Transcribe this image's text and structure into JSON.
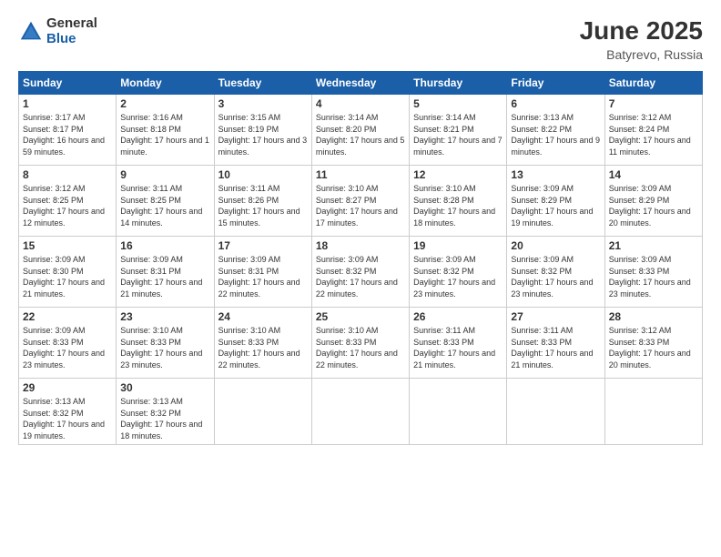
{
  "logo": {
    "general": "General",
    "blue": "Blue"
  },
  "title": "June 2025",
  "location": "Batyrevo, Russia",
  "days_of_week": [
    "Sunday",
    "Monday",
    "Tuesday",
    "Wednesday",
    "Thursday",
    "Friday",
    "Saturday"
  ],
  "weeks": [
    [
      {
        "day": "1",
        "sunrise": "3:17 AM",
        "sunset": "8:17 PM",
        "daylight": "16 hours and 59 minutes."
      },
      {
        "day": "2",
        "sunrise": "3:16 AM",
        "sunset": "8:18 PM",
        "daylight": "17 hours and 1 minute."
      },
      {
        "day": "3",
        "sunrise": "3:15 AM",
        "sunset": "8:19 PM",
        "daylight": "17 hours and 3 minutes."
      },
      {
        "day": "4",
        "sunrise": "3:14 AM",
        "sunset": "8:20 PM",
        "daylight": "17 hours and 5 minutes."
      },
      {
        "day": "5",
        "sunrise": "3:14 AM",
        "sunset": "8:21 PM",
        "daylight": "17 hours and 7 minutes."
      },
      {
        "day": "6",
        "sunrise": "3:13 AM",
        "sunset": "8:22 PM",
        "daylight": "17 hours and 9 minutes."
      },
      {
        "day": "7",
        "sunrise": "3:12 AM",
        "sunset": "8:24 PM",
        "daylight": "17 hours and 11 minutes."
      }
    ],
    [
      {
        "day": "8",
        "sunrise": "3:12 AM",
        "sunset": "8:25 PM",
        "daylight": "17 hours and 12 minutes."
      },
      {
        "day": "9",
        "sunrise": "3:11 AM",
        "sunset": "8:25 PM",
        "daylight": "17 hours and 14 minutes."
      },
      {
        "day": "10",
        "sunrise": "3:11 AM",
        "sunset": "8:26 PM",
        "daylight": "17 hours and 15 minutes."
      },
      {
        "day": "11",
        "sunrise": "3:10 AM",
        "sunset": "8:27 PM",
        "daylight": "17 hours and 17 minutes."
      },
      {
        "day": "12",
        "sunrise": "3:10 AM",
        "sunset": "8:28 PM",
        "daylight": "17 hours and 18 minutes."
      },
      {
        "day": "13",
        "sunrise": "3:09 AM",
        "sunset": "8:29 PM",
        "daylight": "17 hours and 19 minutes."
      },
      {
        "day": "14",
        "sunrise": "3:09 AM",
        "sunset": "8:29 PM",
        "daylight": "17 hours and 20 minutes."
      }
    ],
    [
      {
        "day": "15",
        "sunrise": "3:09 AM",
        "sunset": "8:30 PM",
        "daylight": "17 hours and 21 minutes."
      },
      {
        "day": "16",
        "sunrise": "3:09 AM",
        "sunset": "8:31 PM",
        "daylight": "17 hours and 21 minutes."
      },
      {
        "day": "17",
        "sunrise": "3:09 AM",
        "sunset": "8:31 PM",
        "daylight": "17 hours and 22 minutes."
      },
      {
        "day": "18",
        "sunrise": "3:09 AM",
        "sunset": "8:32 PM",
        "daylight": "17 hours and 22 minutes."
      },
      {
        "day": "19",
        "sunrise": "3:09 AM",
        "sunset": "8:32 PM",
        "daylight": "17 hours and 23 minutes."
      },
      {
        "day": "20",
        "sunrise": "3:09 AM",
        "sunset": "8:32 PM",
        "daylight": "17 hours and 23 minutes."
      },
      {
        "day": "21",
        "sunrise": "3:09 AM",
        "sunset": "8:33 PM",
        "daylight": "17 hours and 23 minutes."
      }
    ],
    [
      {
        "day": "22",
        "sunrise": "3:09 AM",
        "sunset": "8:33 PM",
        "daylight": "17 hours and 23 minutes."
      },
      {
        "day": "23",
        "sunrise": "3:10 AM",
        "sunset": "8:33 PM",
        "daylight": "17 hours and 23 minutes."
      },
      {
        "day": "24",
        "sunrise": "3:10 AM",
        "sunset": "8:33 PM",
        "daylight": "17 hours and 22 minutes."
      },
      {
        "day": "25",
        "sunrise": "3:10 AM",
        "sunset": "8:33 PM",
        "daylight": "17 hours and 22 minutes."
      },
      {
        "day": "26",
        "sunrise": "3:11 AM",
        "sunset": "8:33 PM",
        "daylight": "17 hours and 21 minutes."
      },
      {
        "day": "27",
        "sunrise": "3:11 AM",
        "sunset": "8:33 PM",
        "daylight": "17 hours and 21 minutes."
      },
      {
        "day": "28",
        "sunrise": "3:12 AM",
        "sunset": "8:33 PM",
        "daylight": "17 hours and 20 minutes."
      }
    ],
    [
      {
        "day": "29",
        "sunrise": "3:13 AM",
        "sunset": "8:32 PM",
        "daylight": "17 hours and 19 minutes."
      },
      {
        "day": "30",
        "sunrise": "3:13 AM",
        "sunset": "8:32 PM",
        "daylight": "17 hours and 18 minutes."
      },
      null,
      null,
      null,
      null,
      null
    ]
  ]
}
